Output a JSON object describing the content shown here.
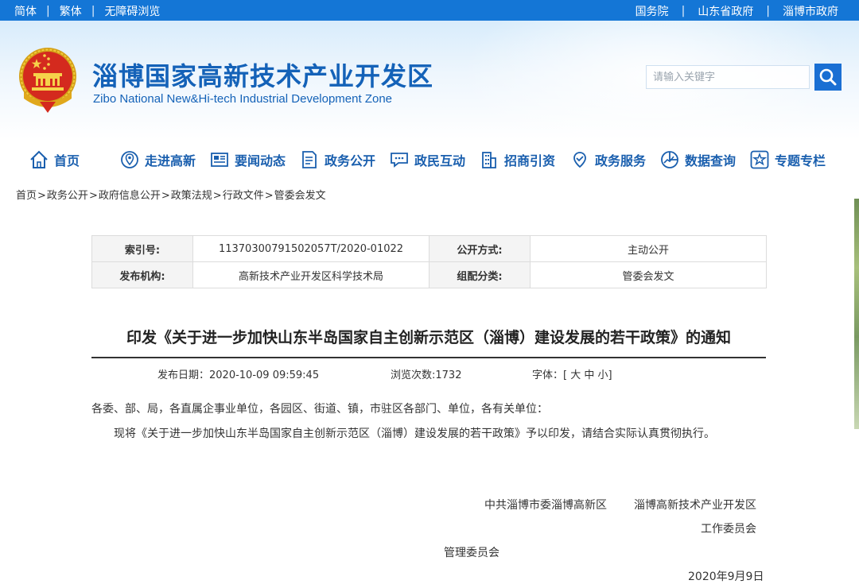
{
  "topbar": {
    "left_links": [
      "简体",
      "繁体",
      "无障碍浏览"
    ],
    "right_links": [
      "国务院",
      "山东省政府",
      "淄博市政府"
    ],
    "separator": "|"
  },
  "header": {
    "title": "淄博国家高新技术产业开发区",
    "subtitle": "Zibo National New&Hi-tech Industrial Development Zone",
    "search_placeholder": "请输入关键字",
    "brand_color": "#1462b8"
  },
  "nav": {
    "items": [
      {
        "label": "首页",
        "icon": "home-icon"
      },
      {
        "label": "走进高新",
        "icon": "location-icon"
      },
      {
        "label": "要闻动态",
        "icon": "news-icon"
      },
      {
        "label": "政务公开",
        "icon": "document-icon"
      },
      {
        "label": "政民互动",
        "icon": "chat-icon"
      },
      {
        "label": "招商引资",
        "icon": "building-icon"
      },
      {
        "label": "政务服务",
        "icon": "service-icon"
      },
      {
        "label": "数据查询",
        "icon": "data-icon"
      },
      {
        "label": "专题专栏",
        "icon": "star-icon"
      }
    ]
  },
  "breadcrumb": {
    "items": [
      "首页",
      "政务公开",
      "政府信息公开",
      "政策法规",
      "行政文件",
      "管委会发文"
    ],
    "separator": ">"
  },
  "meta": {
    "index_label": "索引号:",
    "index_value": "11370300791502057T/2020-01022",
    "public_label": "公开方式:",
    "public_value": "主动公开",
    "agency_label": "发布机构:",
    "agency_value": "高新技术产业开发区科学技术局",
    "category_label": "组配分类:",
    "category_value": "管委会发文"
  },
  "article": {
    "title": "印发《关于进一步加快山东半岛国家自主创新示范区（淄博）建设发展的若干政策》的通知",
    "publish_date_label": "发布日期：",
    "publish_date": "2020-10-09 09:59:45",
    "views_label": "浏览次数:",
    "views": "1732",
    "font_label": "字体：[",
    "font_large": "大",
    "font_medium": "中",
    "font_small": "小",
    "font_close": "]",
    "salutation": "各委、部、局，各直属企事业单位，各园区、街道、镇，市驻区各部门、单位，各有关单位：",
    "paragraph": "现将《关于进一步加快山东半岛国家自主创新示范区（淄博）建设发展的若干政策》予以印发，请结合实际认真贯彻执行。",
    "signature_line1_a": "中共淄博市委淄博高新区",
    "signature_line1_b": "淄博高新技术产业开发区",
    "signature_line2": "工作委员会",
    "signature_line3": "管理委员会",
    "date": "2020年9月9日"
  }
}
